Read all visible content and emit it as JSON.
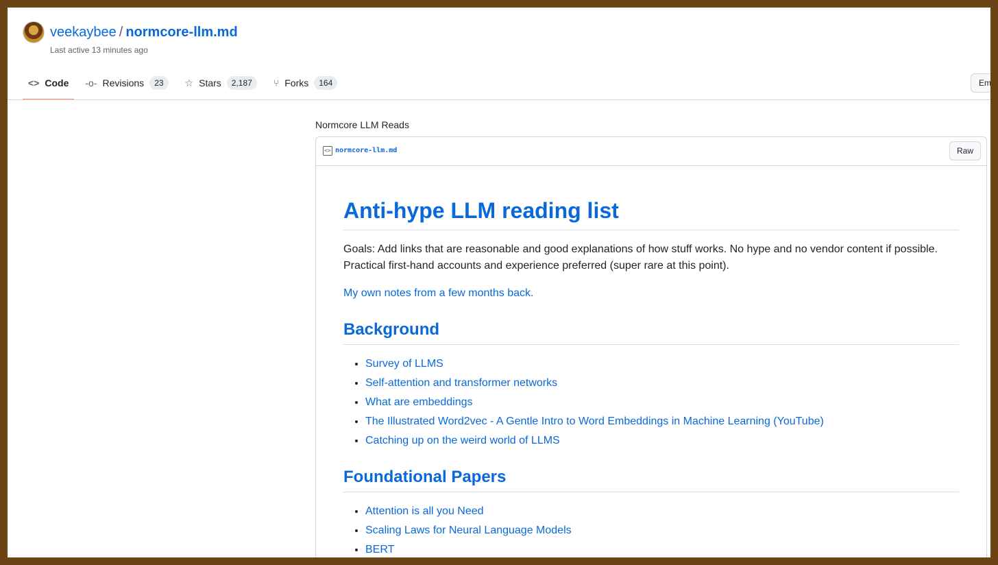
{
  "header": {
    "owner": "veekaybee",
    "separator": "/",
    "gist_name": "normcore-llm.md",
    "last_active": "Last active 13 minutes ago"
  },
  "tabs": [
    {
      "label": "Code",
      "icon": "code-icon",
      "selected": true
    },
    {
      "label": "Revisions",
      "icon": "commit-icon",
      "count": "23"
    },
    {
      "label": "Stars",
      "icon": "star-icon",
      "count": "2,187"
    },
    {
      "label": "Forks",
      "icon": "fork-icon",
      "count": "164"
    }
  ],
  "embed_label": "Em",
  "description": "Normcore LLM Reads",
  "file": {
    "name": "normcore-llm.md",
    "raw_label": "Raw"
  },
  "markdown": {
    "h1": "Anti-hype LLM reading list",
    "goals": "Goals: Add links that are reasonable and good explanations of how stuff works. No hype and no vendor content if possible. Practical first-hand accounts and experience preferred (super rare at this point).",
    "notes_link": "My own notes from a few months back.",
    "sections": [
      {
        "title": "Background",
        "items": [
          "Survey of LLMS",
          "Self-attention and transformer networks",
          "What are embeddings",
          "The Illustrated Word2vec - A Gentle Intro to Word Embeddings in Machine Learning (YouTube)",
          "Catching up on the weird world of LLMS"
        ]
      },
      {
        "title": "Foundational Papers",
        "items": [
          "Attention is all you Need",
          "Scaling Laws for Neural Language Models",
          "BERT"
        ]
      }
    ]
  },
  "colors": {
    "link": "#0969da",
    "tab_underline": "#fd8c73",
    "frame": "#6b4314"
  }
}
